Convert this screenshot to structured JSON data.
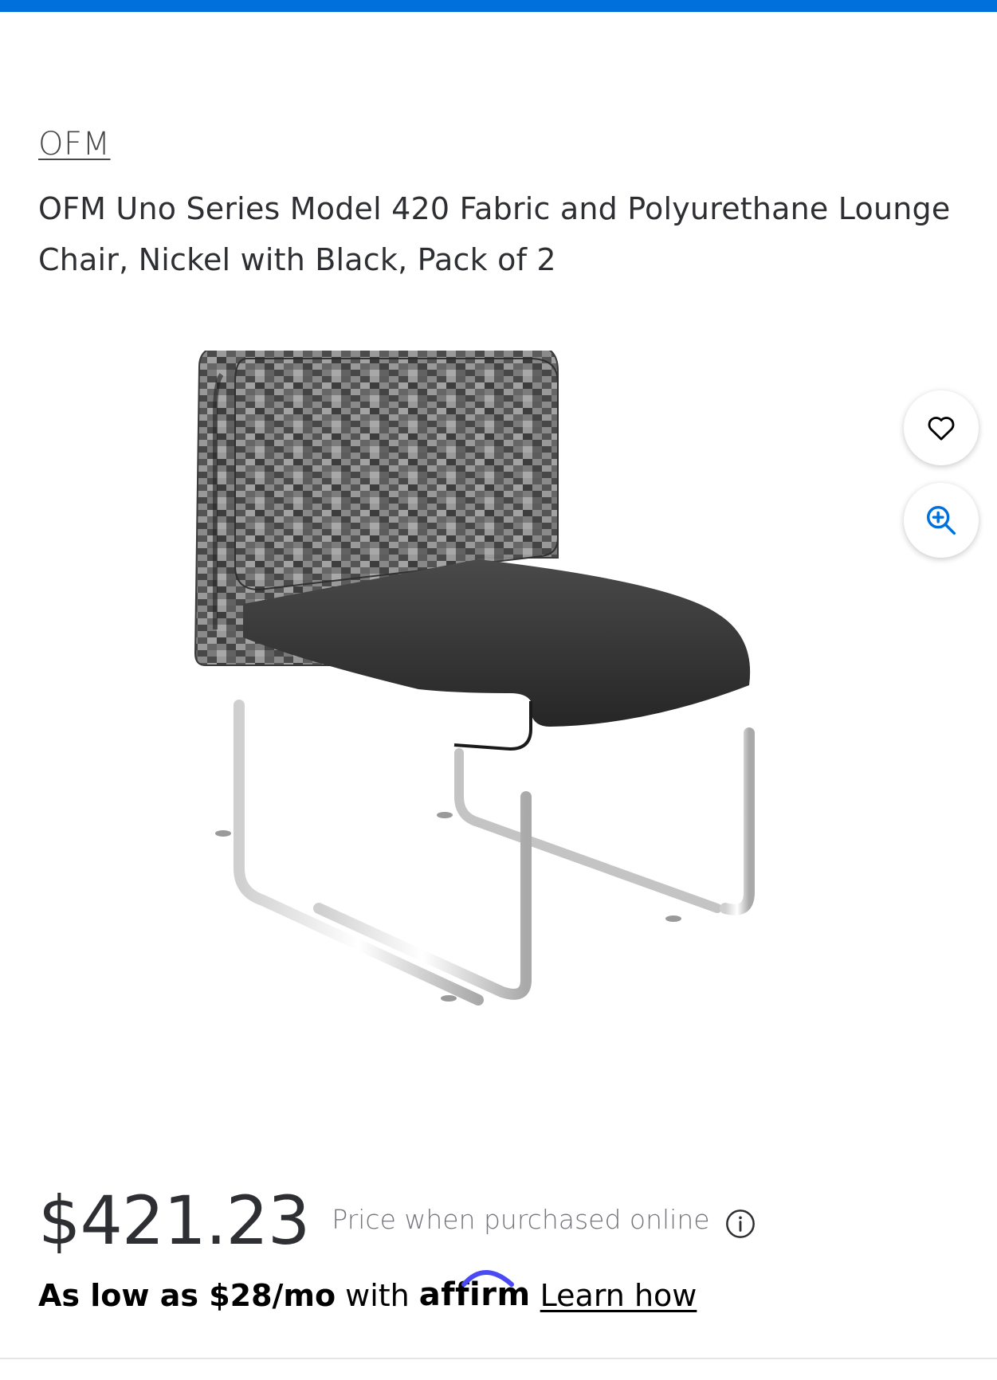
{
  "product": {
    "brand": "OFM",
    "title": "OFM Uno Series Model 420 Fabric and Polyurethane Lounge Chair, Nickel with Black, Pack of 2"
  },
  "actions": {
    "favorite_icon": "heart-icon",
    "zoom_icon": "zoom-in-icon"
  },
  "pricing": {
    "price": "$421.23",
    "price_note": "Price when purchased online",
    "info_icon": "info-icon"
  },
  "financing": {
    "offer": "As low as $28/mo",
    "with": "with",
    "provider": "affirm",
    "learn_link": "Learn how"
  },
  "colors": {
    "accent_bar": "#0071dc",
    "affirm_arc": "#4a4af4",
    "icon_blue": "#0071dc"
  }
}
